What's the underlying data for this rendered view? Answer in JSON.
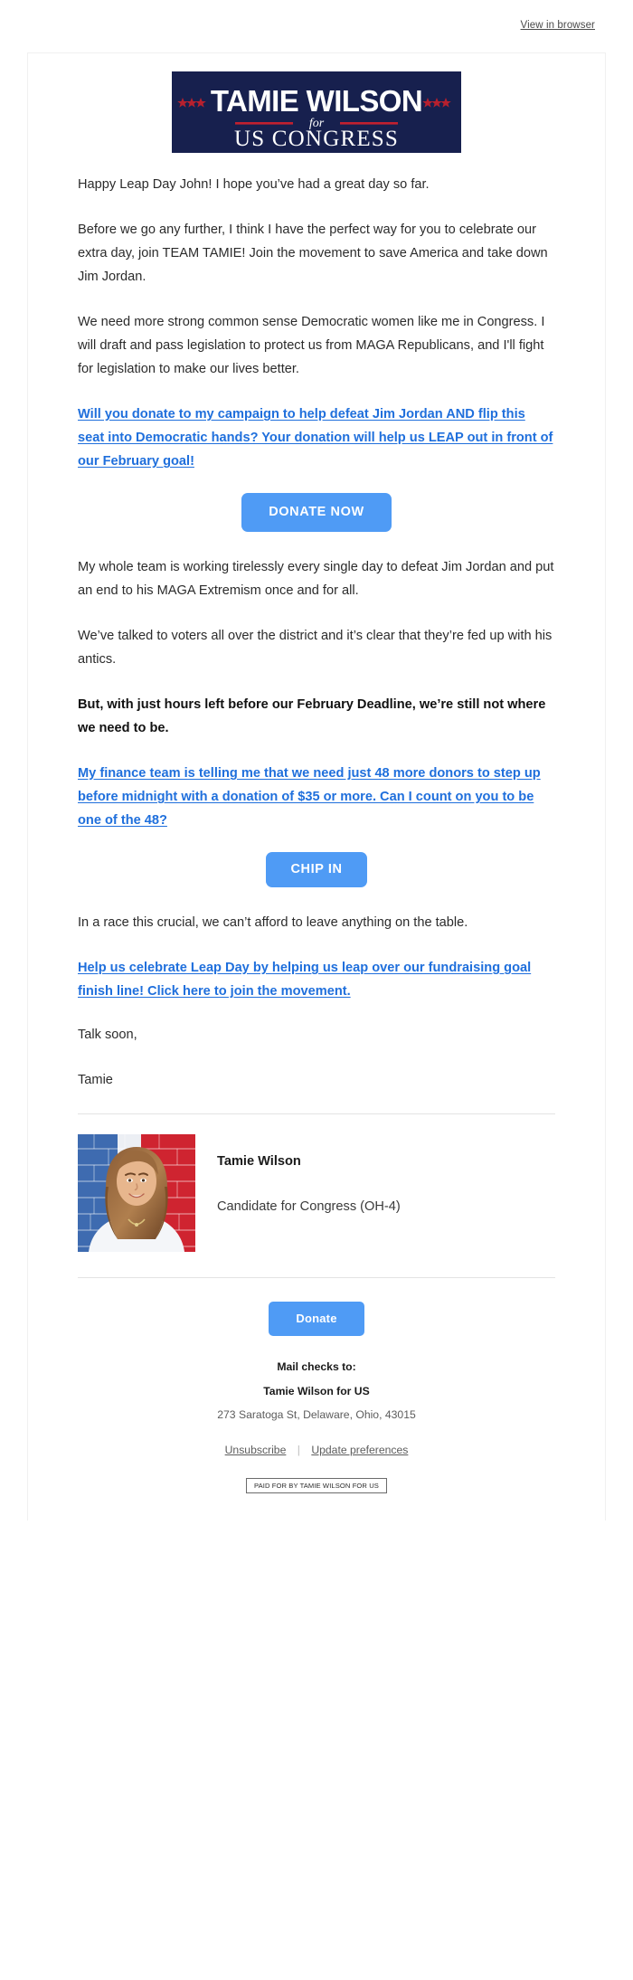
{
  "preheader": {
    "view_in_browser": "View in browser"
  },
  "logo": {
    "name_line": "TAMIE WILSON",
    "for_word": "for",
    "office_line": "US CONGRESS",
    "bg_color": "#17204e",
    "star_color": "#b7202e",
    "rule_color": "#c1202f"
  },
  "body": {
    "p1": "Happy Leap Day John! I hope you’ve had a great day so far.",
    "p2": "Before we go any further, I think I have the perfect way for you to celebrate our extra day, join TEAM TAMIE! Join the movement to save America and take down Jim Jordan.",
    "p3": "We need more strong common sense Democratic women like me in Congress. I will draft and pass legislation to protect us from MAGA Republicans, and I'll fight for legislation to make our lives better.",
    "link1": "Will you donate to my campaign to help defeat Jim Jordan AND flip this seat into Democratic hands? Your donation will help us LEAP out in front of our February goal!",
    "cta1_label": "DONATE NOW",
    "p4": "My whole team is working tirelessly every single day to defeat Jim Jordan and put an end to his MAGA Extremism once and for all.",
    "p5": "We’ve talked to voters all over the district and it’s clear that they’re fed up with his antics.",
    "p6_bold": "But, with just hours left before our February Deadline, we’re still not where we need to be.",
    "link2": "My finance team is telling me that we need just 48 more donors to step up before midnight with a donation of $35 or more. Can I count on you to be one of the 48?",
    "cta2_label": "CHIP IN",
    "p7": "In a race this crucial, we can’t afford to leave anything on the table.",
    "link3": "Help us celebrate Leap Day by helping us leap over our fundraising goal finish line! Click here to join the movement.",
    "signoff": "Talk soon,",
    "signature": "Tamie"
  },
  "signature_block": {
    "photo_alt": "candidate-headshot",
    "name": "Tamie Wilson",
    "role": "Candidate for Congress (OH-4)"
  },
  "footer": {
    "donate_label": "Donate",
    "mail_checks_label": "Mail checks to:",
    "payee": "Tamie Wilson for US",
    "address": "273 Saratoga St, Delaware, Ohio, 43015",
    "unsubscribe": "Unsubscribe",
    "separator": "|",
    "update_preferences": "Update preferences",
    "disclaimer": "PAID FOR BY TAMIE WILSON FOR US"
  },
  "colors": {
    "link_blue": "#1f6fdc",
    "button_blue": "#4f9bf5",
    "navy": "#17204e",
    "red": "#c1202f",
    "body_text": "#2b2b2b"
  }
}
